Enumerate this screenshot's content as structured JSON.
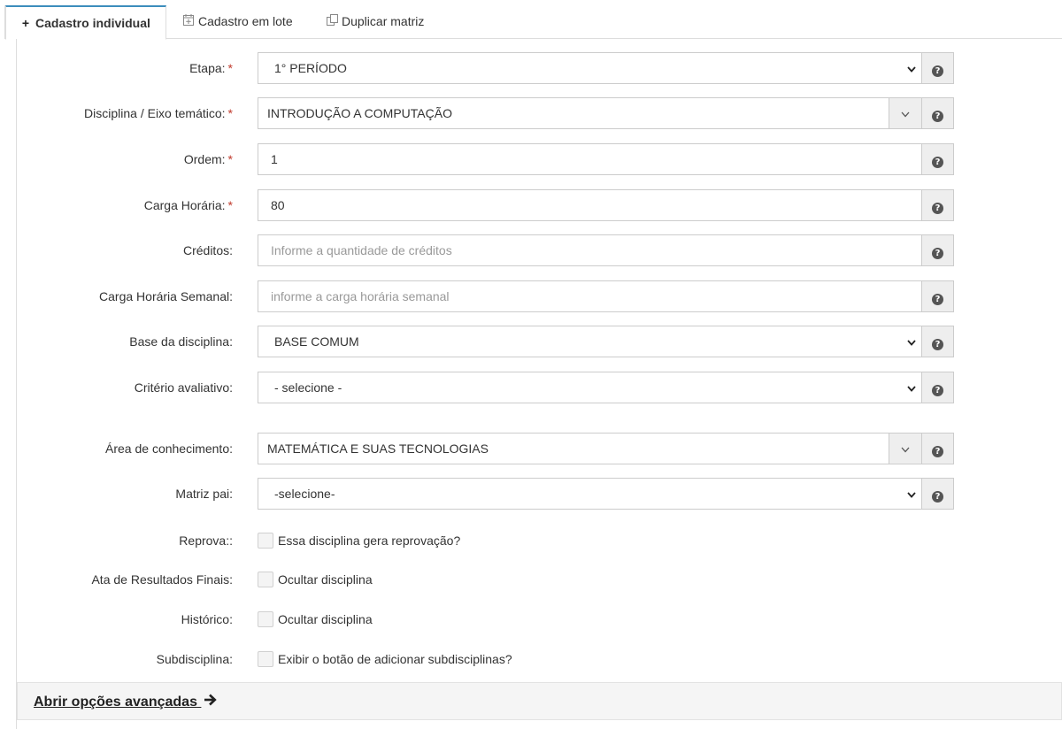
{
  "tabs": [
    {
      "label": "Cadastro individual",
      "icon": "plus-icon",
      "active": true
    },
    {
      "label": "Cadastro em lote",
      "icon": "calendar-plus-icon",
      "active": false
    },
    {
      "label": "Duplicar matriz",
      "icon": "copy-icon",
      "active": false
    }
  ],
  "icons": {
    "plus": "+",
    "help": "?",
    "arrow": "→"
  },
  "form": {
    "etapa": {
      "label": "Etapa:",
      "required": "*",
      "value": "1° PERÍODO"
    },
    "disciplina": {
      "label": "Disciplina / Eixo temático:",
      "required": "*",
      "value": "INTRODUÇÃO A COMPUTAÇÃO"
    },
    "ordem": {
      "label": "Ordem:",
      "required": "*",
      "value": "1"
    },
    "carga_horaria": {
      "label": "Carga Horária:",
      "required": "*",
      "value": "80"
    },
    "creditos": {
      "label": "Créditos:",
      "placeholder": "Informe a quantidade de créditos"
    },
    "carga_semanal": {
      "label": "Carga Horária Semanal:",
      "placeholder": "informe a carga horária semanal"
    },
    "base": {
      "label": "Base da disciplina:",
      "value": "BASE COMUM"
    },
    "criterio": {
      "label": "Critério avaliativo:",
      "value": "- selecione -"
    },
    "area": {
      "label": "Área de conhecimento:",
      "value": "MATEMÁTICA E SUAS TECNOLOGIAS"
    },
    "matriz_pai": {
      "label": "Matriz pai:",
      "value": "-selecione-"
    },
    "reprova": {
      "label": "Reprova::",
      "text": "Essa disciplina gera reprovação?",
      "checked": false
    },
    "ata": {
      "label": "Ata de Resultados Finais:",
      "text": "Ocultar disciplina",
      "checked": false
    },
    "historico": {
      "label": "Histórico:",
      "text": "Ocultar disciplina",
      "checked": false
    },
    "subdisciplina": {
      "label": "Subdisciplina:",
      "text": "Exibir o botão de adicionar subdisciplinas?",
      "checked": false
    }
  },
  "advanced": {
    "label": "Abrir opções avançadas"
  },
  "colors": {
    "accent": "#3c8dbc",
    "required": "#c0392b",
    "help_bg": "#555555"
  }
}
